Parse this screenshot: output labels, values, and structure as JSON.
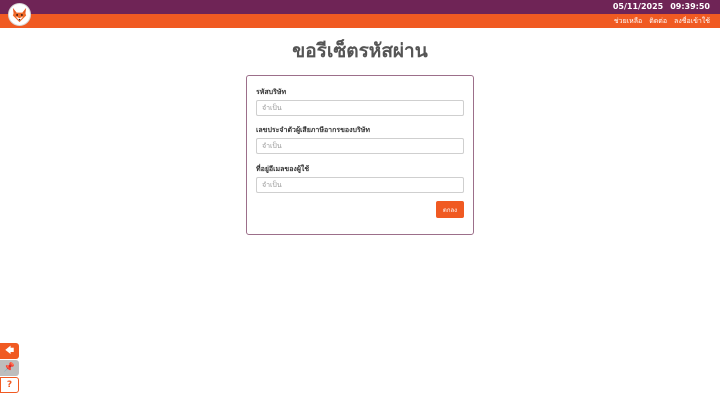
{
  "header": {
    "date": "05/11/2025",
    "time": "09:39:50",
    "nav": [
      "ช่วยเหลือ",
      "ติดต่อ",
      "ลงชื่อเข้าใช้"
    ]
  },
  "page": {
    "title": "ขอรีเซ็ตรหัสผ่าน"
  },
  "form": {
    "fields": [
      {
        "label": "รหัสบริษัท",
        "placeholder": "จำเป็น",
        "value": ""
      },
      {
        "label": "เลขประจำตัวผู้เสียภาษีอากรของบริษัท",
        "placeholder": "จำเป็น",
        "value": ""
      },
      {
        "label": "ที่อยู่อีเมลของผู้ใช้",
        "placeholder": "จำเป็น",
        "value": ""
      }
    ],
    "submit_label": "ตกลง"
  },
  "side_buttons": {
    "back_icon": "🡄",
    "pin_icon": "📌",
    "help_icon": "?"
  },
  "colors": {
    "topbar": "#6f2456",
    "accent": "#f05a22",
    "card_border": "#9c6f8a"
  }
}
